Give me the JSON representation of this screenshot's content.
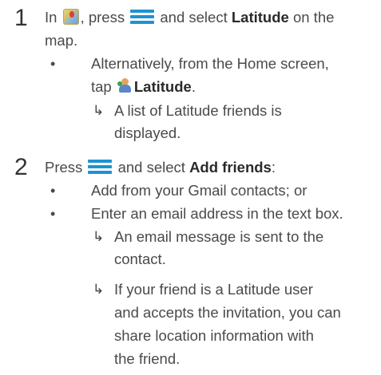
{
  "steps": [
    {
      "number": "1",
      "line1_before_icon": "In ",
      "line1_after_icon": ", press ",
      "line1_after_menu": " and select ",
      "line1_bold": "Latitude",
      "line1_end": " on the",
      "line2": "map.",
      "bullet": {
        "line1": "Alternatively, from the Home screen,",
        "line2_before_icon": "tap ",
        "line2_bold": "Latitude",
        "line2_end": ".",
        "result": {
          "line1": "A list of Latitude friends is",
          "line2": "displayed."
        }
      }
    },
    {
      "number": "2",
      "line1_before_menu": "Press ",
      "line1_after_menu": " and select ",
      "line1_bold": "Add friends",
      "line1_end": ":",
      "bullets": [
        "Add from your Gmail contacts; or",
        "Enter an email address in the text box."
      ],
      "results": [
        {
          "line1": "An email message is sent to the",
          "line2": "contact."
        },
        {
          "line1": "If your friend is a Latitude user",
          "line2": "and accepts the invitation, you can",
          "line3": "share location information with",
          "line4": "the friend."
        }
      ]
    }
  ],
  "symbols": {
    "bullet": "•",
    "arrow": "↳",
    "icons": [
      "maps-app-icon",
      "menu-icon",
      "latitude-app-icon"
    ],
    "menu_icon_color": "#1d92d3"
  }
}
